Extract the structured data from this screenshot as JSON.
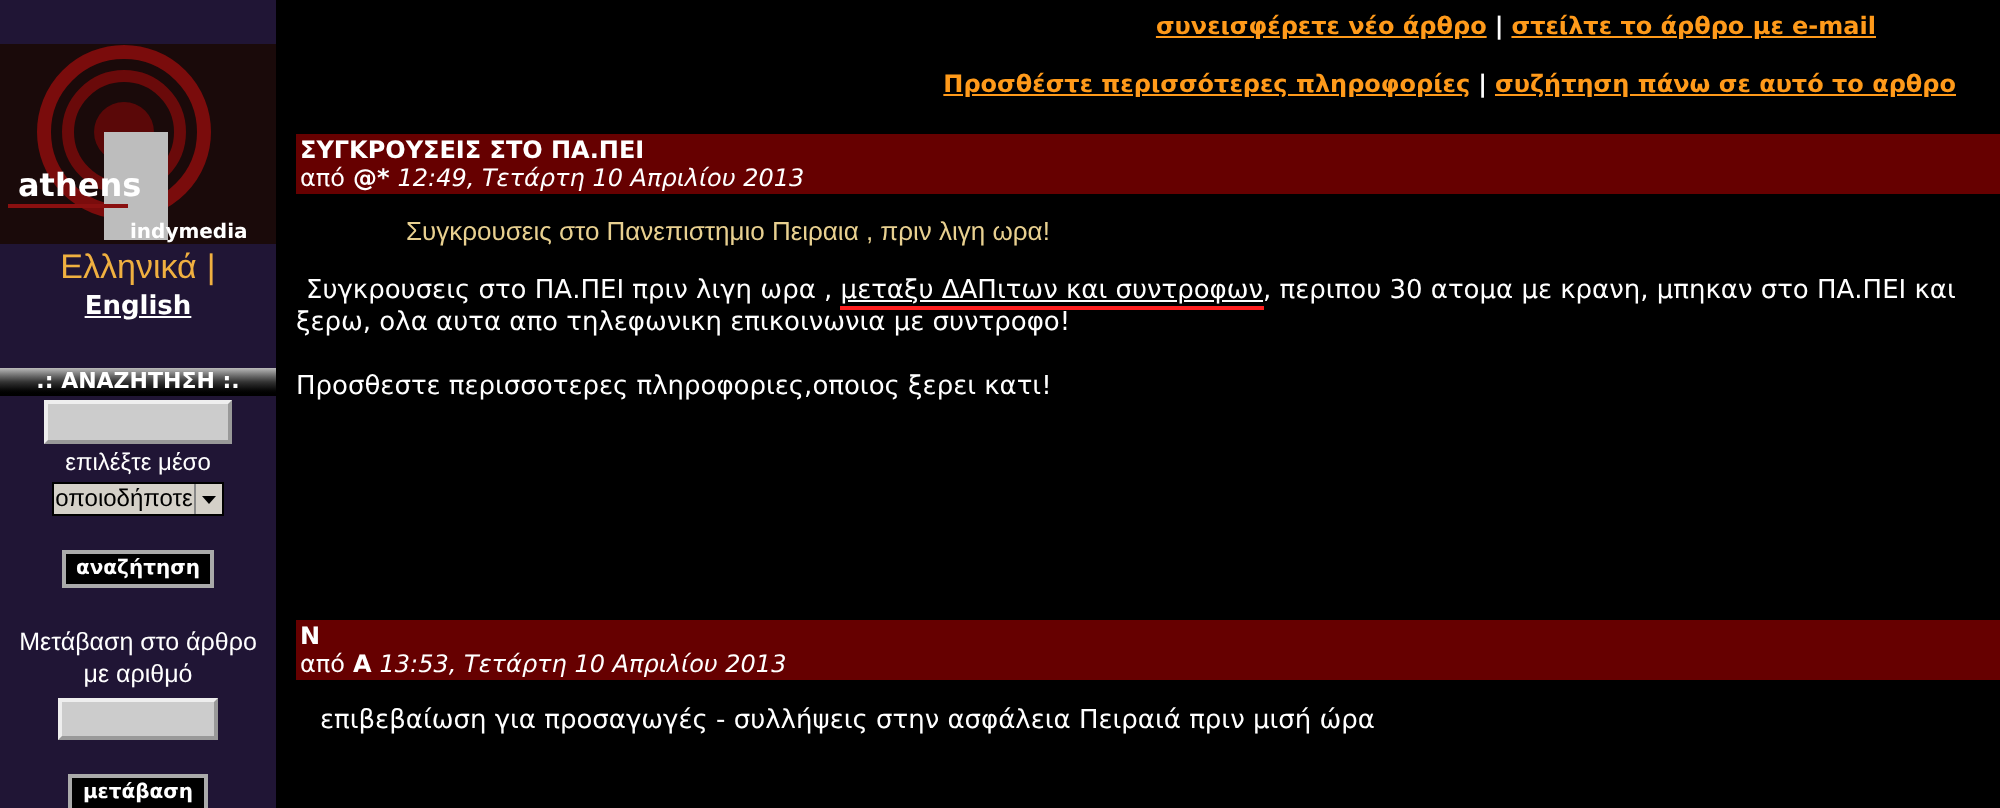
{
  "sidebar": {
    "logo": {
      "word_1": "athens",
      "word_2": "indymedia"
    },
    "languages": [
      {
        "label": "Ελληνικά",
        "selected": true,
        "separator": "|"
      },
      {
        "label": "English",
        "selected": false
      }
    ],
    "search": {
      "heading": ".: ΑΝΑΖΗΤΗΣΗ :.",
      "medium_label": "επιλέξτε μέσο",
      "medium_value": "οποιοδήποτε",
      "button": "αναζήτηση"
    },
    "goto": {
      "label": "Μετάβαση στο άρθρο με αριθμό",
      "button": "μετάβαση"
    }
  },
  "actions": [
    {
      "links": [
        "συνεισφέρετε νέο άρθρο",
        "στείλτε το άρθρο με e-mail"
      ],
      "separator": "|"
    },
    {
      "links": [
        "Προσθέστε περισσότερες πληροφορίες",
        "συζήτηση πάνω σε αυτό το αρθρο"
      ],
      "separator": "|"
    }
  ],
  "articles": [
    {
      "title": "ΣΥΓΚΡΟΥΣΕΙΣ ΣΤΟ ΠΑ.ΠΕΙ",
      "by": "από",
      "author": "@*",
      "time": "12:49, Τετάρτη 10 Απριλίου 2013",
      "summary": "Συγκρουσεις στο Πανεπιστημιο Πειραια , πριν λιγη ωρα!",
      "body": [
        {
          "before": "Συγκρουσεις στο ΠΑ.ΠΕΙ πριν λιγη ωρα , ",
          "underlined": "μεταξυ ΔΑΠιτων και συντροφων",
          "after": ", περιπου 30 ατομα με κρανη, μπηκαν στο ΠΑ.ΠΕΙ και ξερω, ολα αυτα απο τηλεφωνικη επικοινωνια με συντροφο!"
        },
        {
          "before": "Προσθεστε περισσοτερες πληροφοριες,οποιος ξερει κατι!"
        }
      ]
    },
    {
      "title": "Ν",
      "by": "από",
      "author": "Α",
      "time": "13:53, Τετάρτη 10 Απριλίου 2013",
      "body": [
        {
          "before": "επιβεβαίωση για προσαγωγές - συλλήψεις στην ασφάλεια Πειραιά πριν μισή ώρα"
        }
      ]
    }
  ]
}
